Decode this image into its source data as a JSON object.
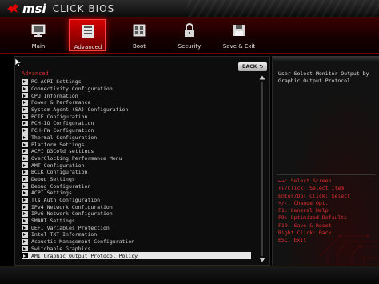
{
  "header": {
    "brand_logo": "msi",
    "brand_product": "CLICK BIOS",
    "logo_icon": "dragon-icon"
  },
  "nav": {
    "items": [
      {
        "label": "Main",
        "icon": "monitor-icon",
        "active": false
      },
      {
        "label": "Advanced",
        "icon": "list-icon",
        "active": true
      },
      {
        "label": "Boot",
        "icon": "boot-icon",
        "active": false
      },
      {
        "label": "Security",
        "icon": "lock-icon",
        "active": false
      },
      {
        "label": "Save & Exit",
        "icon": "floppy-icon",
        "active": false
      }
    ]
  },
  "main": {
    "back_label": "BACK",
    "section_title": "Advanced",
    "items": [
      "RC ACPI Settings",
      "Connectivity Configuration",
      "CPU Information",
      "Power & Performance",
      "System Agent (SA) Configuration",
      "PCIE Configuration",
      "PCH-IO Configuration",
      "PCH-FW Configuration",
      "Thermal Configuration",
      "Platform Settings",
      "ACPI D3Cold settings",
      "OverClocking Performance Menu",
      "AMT Configuration",
      "BCLK Configuration",
      "Debug Settings",
      "Debug Configuration",
      "ACPI Settings",
      "Tls Auth Configuration",
      "IPv4 Network Configuration",
      "IPv6 Network Configuration",
      "SMART Settings",
      "UEFI Variables Protection",
      "Intel TXT Information",
      "Acoustic Management Configuration",
      "Switchable Graphics",
      "AMI Graphic Output Protocol Policy"
    ],
    "selected_index": 25
  },
  "help": {
    "description": "User Select Monitor Output by Graphic Output Protocol",
    "keys": [
      "←→: Select Screen",
      "↑↓/Click: Select Item",
      "Enter/Dbl Click: Select",
      "+/-: Change Opt.",
      "F1: General Help",
      "F9: Optimized Defaults",
      "F10: Save & Reset",
      "Right Click: Back",
      "ESC: Exit"
    ]
  },
  "colors": {
    "accent": "#d40000",
    "help_text": "#e03030",
    "selection": "#e6e6e6"
  }
}
